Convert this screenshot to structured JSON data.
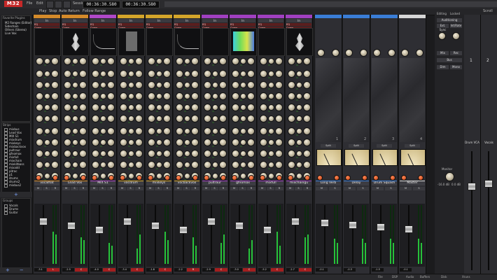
{
  "app": {
    "logo_text": "M32",
    "menus": [
      "File",
      "Edit",
      "Session",
      "Track",
      "Window"
    ],
    "transport": [
      "Play",
      "Stop",
      "Auto Return",
      "Follow Range"
    ],
    "primary_clock": "00:36:30.580",
    "secondary_clock": "00:36:30.580",
    "right_menu": "Scroll"
  },
  "sidebar": {
    "tree_title": "Favorite Plugins",
    "tree_items": [
      "M2 Ranges (Editor)",
      "Sidechain",
      "Others (Stereo)",
      "Live Vox"
    ],
    "strips_title": "Strips",
    "strips": [
      "mixbus",
      "Lead Vox",
      "MIX S1",
      "mixdrum",
      "mixkeys",
      "mixbackvox",
      "pultraur",
      "gfnomax",
      "mixfull",
      "mixchain",
      "mixkitbass",
      "mixadd",
      "pitrac",
      "p1",
      "drums",
      "drums2",
      "mixbus2"
    ],
    "groups_title": "Groups",
    "groups": [
      "Vocals",
      "Drums",
      "Guitar"
    ]
  },
  "channels": [
    {
      "name": "vocalflat",
      "color": "#d48a2a",
      "input": "In",
      "plugins": [
        "EQ",
        "Comp"
      ],
      "gain": "-3.1",
      "pan": "L",
      "assign": "Auto"
    },
    {
      "name": "Lead Vox",
      "color": "#d48a2a",
      "input": "In",
      "plugins": [
        "EQ",
        "Comp"
      ],
      "gain": "-2.5",
      "pan": "C",
      "assign": "Auto"
    },
    {
      "name": "MIX S1",
      "color": "#b048c8",
      "input": "In",
      "plugins": [
        "EQ",
        "Comp",
        "ACE Delay"
      ],
      "gain": "-4.0",
      "pan": "C",
      "assign": "Auto"
    },
    {
      "name": "vocdrum",
      "color": "#d4a52a",
      "input": "In",
      "plugins": [
        "EQ",
        "Comp"
      ],
      "gain": "-3.4",
      "pan": "C",
      "assign": "Auto"
    },
    {
      "name": "mixkeys",
      "color": "#d4a52a",
      "input": "In",
      "plugins": [
        "EQ",
        "Comp"
      ],
      "gain": "-1.8",
      "pan": "C",
      "assign": "Auto"
    },
    {
      "name": "vocbackvox",
      "color": "#d4a52a",
      "input": "In",
      "plugins": [
        "EQ",
        "Comp"
      ],
      "gain": "-2.2",
      "pan": "R",
      "assign": "Auto"
    },
    {
      "name": "pultraur",
      "color": "#a040c0",
      "input": "In",
      "plugins": [
        "EQ",
        "Comp"
      ],
      "gain": "-2.9",
      "pan": "C",
      "assign": "Auto"
    },
    {
      "name": "gfnomax",
      "color": "#a040c0",
      "input": "In",
      "plugins": [
        "EQ",
        "Comp"
      ],
      "gain": "-3.0",
      "pan": "C",
      "assign": "Auto"
    },
    {
      "name": "mixfull",
      "color": "#a040c0",
      "input": "In",
      "plugins": [
        "EQ",
        "Comp"
      ],
      "gain": "-5.2",
      "pan": "C",
      "assign": "Auto"
    },
    {
      "name": "mixchaingu",
      "color": "#a040c0",
      "input": "In",
      "plugins": [
        "EQ",
        "Comp"
      ],
      "gain": "-2.7",
      "pan": "C",
      "assign": "Auto"
    }
  ],
  "buses": [
    {
      "name": "Long Verb",
      "color": "#3a7dd6",
      "number": "1",
      "gain": "-0.1"
    },
    {
      "name": "Delay",
      "color": "#3a7dd6",
      "number": "2",
      "gain": "-0.3"
    },
    {
      "name": "Drum Squash",
      "color": "#3a7dd6",
      "number": "3",
      "gain": "-1.5"
    },
    {
      "name": "Master",
      "color": "#d6d6d6",
      "number": "4",
      "gain": "-0.1"
    }
  ],
  "right_panel": {
    "labels": [
      "Editing",
      "Locked",
      "Auditioning",
      "Ext. Sync",
      "Int/Rate",
      "Mix",
      "Rec",
      "Bus",
      "Monitor",
      "Dim",
      "Mono"
    ],
    "monitor_value": "-16.0 dB",
    "dim_value": "0.0 dB"
  },
  "vcas": [
    {
      "number": "1",
      "name": "Drum VCA",
      "gain": "0.0"
    },
    {
      "number": "2",
      "name": "Vocals",
      "gain": "0.0"
    }
  ],
  "status": [
    "File",
    "DSP",
    "Audio",
    "Buffers",
    "Disk",
    "Xruns"
  ]
}
